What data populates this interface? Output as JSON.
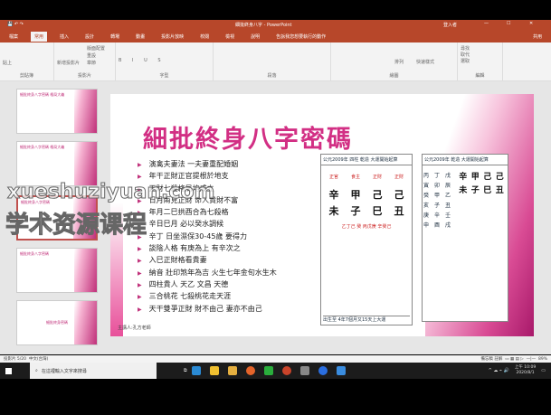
{
  "window": {
    "title": "細批終身八字 - PowerPoint",
    "user": "登入者",
    "controls": [
      "—",
      "☐",
      "✕"
    ]
  },
  "tabs": [
    "檔案",
    "常用",
    "插入",
    "設計",
    "轉場",
    "動畫",
    "投影片放映",
    "校閱",
    "檢視",
    "說明",
    "告訴我您想要執行的動作"
  ],
  "share": "共用",
  "ribbon_groups": [
    "剪貼簿",
    "投影片",
    "字型",
    "段落",
    "繪圖",
    "編輯"
  ],
  "ribbon_buttons": {
    "paste": "貼上",
    "new_slide": "新增投影片",
    "layout": "版面配置",
    "reset": "重設",
    "section": "章節",
    "arrange": "排列",
    "quick_styles": "快速樣式",
    "find": "尋找",
    "replace": "取代",
    "select": "選取"
  },
  "thumbnails": [
    {
      "num": "3",
      "title": "細批終身八字密碼 格局大義"
    },
    {
      "num": "4",
      "title": "細批終身八字密碼 格局大義"
    },
    {
      "num": "5",
      "title": "細批終身八字密碼"
    },
    {
      "num": "6",
      "title": "細批終身八字密碼"
    },
    {
      "num": "7",
      "title": "細批終身密碼"
    }
  ],
  "slide": {
    "title": "細批終身八字密碼",
    "bullets": [
      "演禽夫妻法 一夫妻重配婚姻",
      "年干正財正官提根於地支",
      "正財七殺格局均成立",
      "日月兩見正財 命人貴財不富",
      "年月二巳拱酉合為七殺格",
      "辛日巳月 必以癸水調候",
      "辛丁 日坐濕保30-45歲 要得力",
      "談陰人格 有庚為上 有辛次之",
      "入巳正財格看貴妻",
      "納音 壯印煞年為吉 火生七年金旬水生木",
      "四柱貴人 天乙 文昌 天德",
      "三合桃花 七殺桃花走天涯",
      "天干雙爭正財 財不由己 妻亦不由己"
    ],
    "footer": "主講人:孔方老師",
    "chart1": {
      "header": "公元2009年 四柱 乾造 大運開始起算",
      "gods": [
        "正官",
        "食主",
        "正財",
        "正財"
      ],
      "stems": [
        "辛",
        "甲",
        "己",
        "己"
      ],
      "branches": [
        "未",
        "子",
        "巳",
        "丑"
      ],
      "hidden": "乙丁己 癸 丙戊庚 辛癸己",
      "footer": "出生至 4年7個月又15天上大運"
    },
    "chart2": {
      "header": "公元2009年 乾造 大運開始起算",
      "stems": [
        "辛",
        "甲",
        "己",
        "己"
      ],
      "branches": [
        "未",
        "子",
        "巳",
        "丑"
      ],
      "left_cols": [
        "丙",
        "丁",
        "戊",
        "寅",
        "卯",
        "辰",
        "癸",
        "甲",
        "乙",
        "亥",
        "子",
        "丑",
        "庚",
        "辛",
        "壬",
        "申",
        "酉",
        "戌"
      ]
    }
  },
  "status": {
    "slide_pos": "投影片 5/20",
    "lang": "中文(台灣)",
    "notes": "備忘稿",
    "comments": "註解",
    "zoom": "89%"
  },
  "taskbar": {
    "search_placeholder": "在這裡輸入文字來搜尋",
    "time": "上午 10:09",
    "date": "2020/8/1"
  },
  "watermark": {
    "latin": "xueshuziyuan.com",
    "chinese": "学术资源课程"
  },
  "colors": {
    "accent": "#b7472a",
    "slide_pink": "#d22f84"
  }
}
